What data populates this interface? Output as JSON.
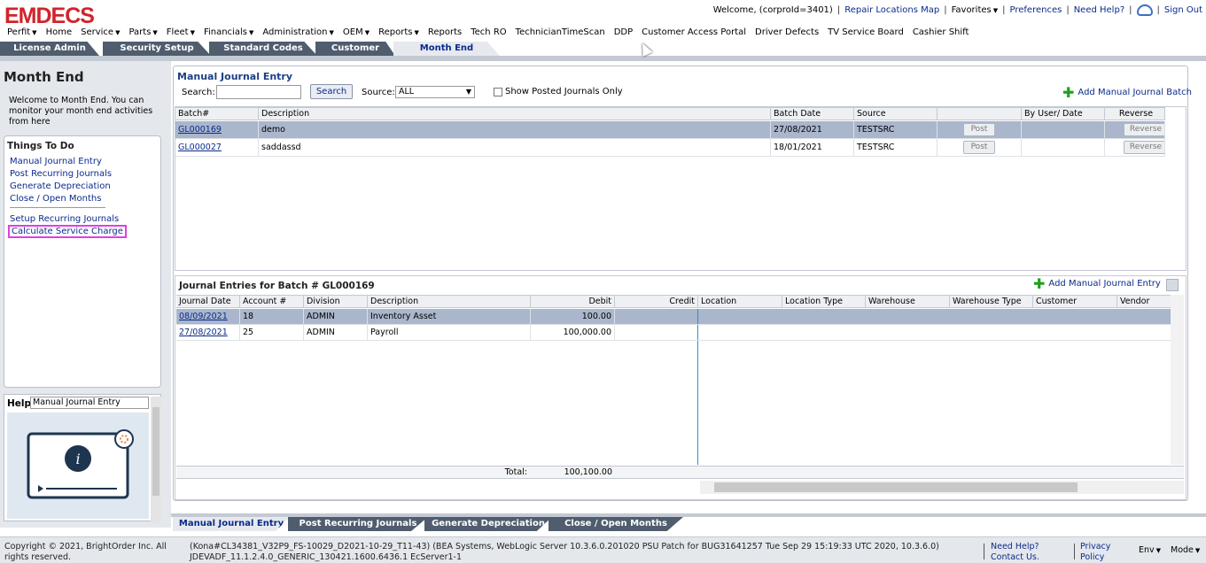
{
  "header": {
    "logo": "EMDECS",
    "welcome": "Welcome, (corproId=3401)",
    "repair_map": "Repair Locations Map",
    "favorites": "Favorites",
    "preferences": "Preferences",
    "need_help": "Need Help?",
    "sign_out": "Sign Out"
  },
  "menu": [
    "Perfit",
    "Home",
    "Service",
    "Parts",
    "Fleet",
    "Financials",
    "Administration",
    "OEM",
    "Reports",
    "Reports",
    "Tech RO",
    "TechnicianTimeScan",
    "DDP",
    "Customer Access Portal",
    "Driver Defects",
    "TV Service Board",
    "Cashier Shift"
  ],
  "menu_dropdowns": [
    true,
    false,
    true,
    true,
    true,
    true,
    true,
    true,
    true,
    false,
    false,
    false,
    false,
    false,
    false,
    false,
    false
  ],
  "tabs": [
    "License Admin",
    "Security Setup",
    "Standard Codes",
    "Customer",
    "Month End"
  ],
  "left": {
    "title": "Month End",
    "welcome": "Welcome to Month End. You can monitor your month end activities from here",
    "todo_title": "Things To Do",
    "todo_items": [
      "Manual Journal Entry",
      "Post Recurring Journals",
      "Generate Depreciation",
      "Close / Open Months"
    ],
    "todo_items2": [
      "Setup Recurring Journals",
      "Calculate Service Charge"
    ],
    "help_label": "Help",
    "help_value": "Manual Journal Entry"
  },
  "mje": {
    "title": "Manual Journal Entry",
    "search_label": "Search:",
    "search_value": "",
    "search_button": "Search",
    "source_label": "Source:",
    "source_value": "ALL",
    "show_posted_label": "Show Posted Journals Only",
    "add_batch": "Add Manual Journal Batch",
    "columns": [
      "Batch#",
      "Description",
      "Batch Date",
      "Source",
      "",
      "By User/ Date",
      "Reverse"
    ],
    "rows": [
      {
        "batch": "GL000169",
        "description": "demo",
        "date": "27/08/2021",
        "source": "TESTSRC",
        "post": "Post",
        "user": "",
        "reverse": "Reverse"
      },
      {
        "batch": "GL000027",
        "description": "saddassd",
        "date": "18/01/2021",
        "source": "TESTSRC",
        "post": "Post",
        "user": "",
        "reverse": "Reverse"
      }
    ]
  },
  "je": {
    "title": "Journal Entries for Batch # GL000169",
    "add_entry": "Add Manual Journal Entry",
    "columns": [
      "Journal Date",
      "Account #",
      "Division",
      "Description",
      "Debit",
      "Credit",
      "Location",
      "Location Type",
      "Warehouse",
      "Warehouse Type",
      "Customer",
      "Vendor"
    ],
    "rows": [
      {
        "date": "08/09/2021",
        "account": "18",
        "division": "ADMIN",
        "description": "Inventory Asset",
        "debit": "100.00",
        "credit": ""
      },
      {
        "date": "27/08/2021",
        "account": "25",
        "division": "ADMIN",
        "description": "Payroll",
        "debit": "100,000.00",
        "credit": ""
      }
    ],
    "total_label": "Total:",
    "total_debit": "100,100.00"
  },
  "bottom_tabs": [
    "Manual Journal Entry",
    "Post Recurring Journals",
    "Generate Depreciation",
    "Close / Open Months"
  ],
  "footer": {
    "copyright": "Copyright © 2021, BrightOrder Inc. All rights reserved.",
    "build": "(Kona#CL34381_V32P9_FS-10029_D2021-10-29_T11-43) (BEA Systems, WebLogic Server 10.3.6.0.201020 PSU Patch for BUG31641257 Tue Sep 29 15:19:33 UTC 2020, 10.3.6.0) JDEVADF_11.1.2.4.0_GENERIC_130421.1600.6436.1 EcServer1-1",
    "need_help": "Need Help? Contact Us.",
    "privacy": "Privacy Policy",
    "env": "Env",
    "mode": "Mode"
  },
  "colors": {
    "brand": "#d2232a",
    "tab_dark": "#4f5d6e",
    "selected_row": "#a9b6cc",
    "highlight_box": "#e040e0"
  }
}
